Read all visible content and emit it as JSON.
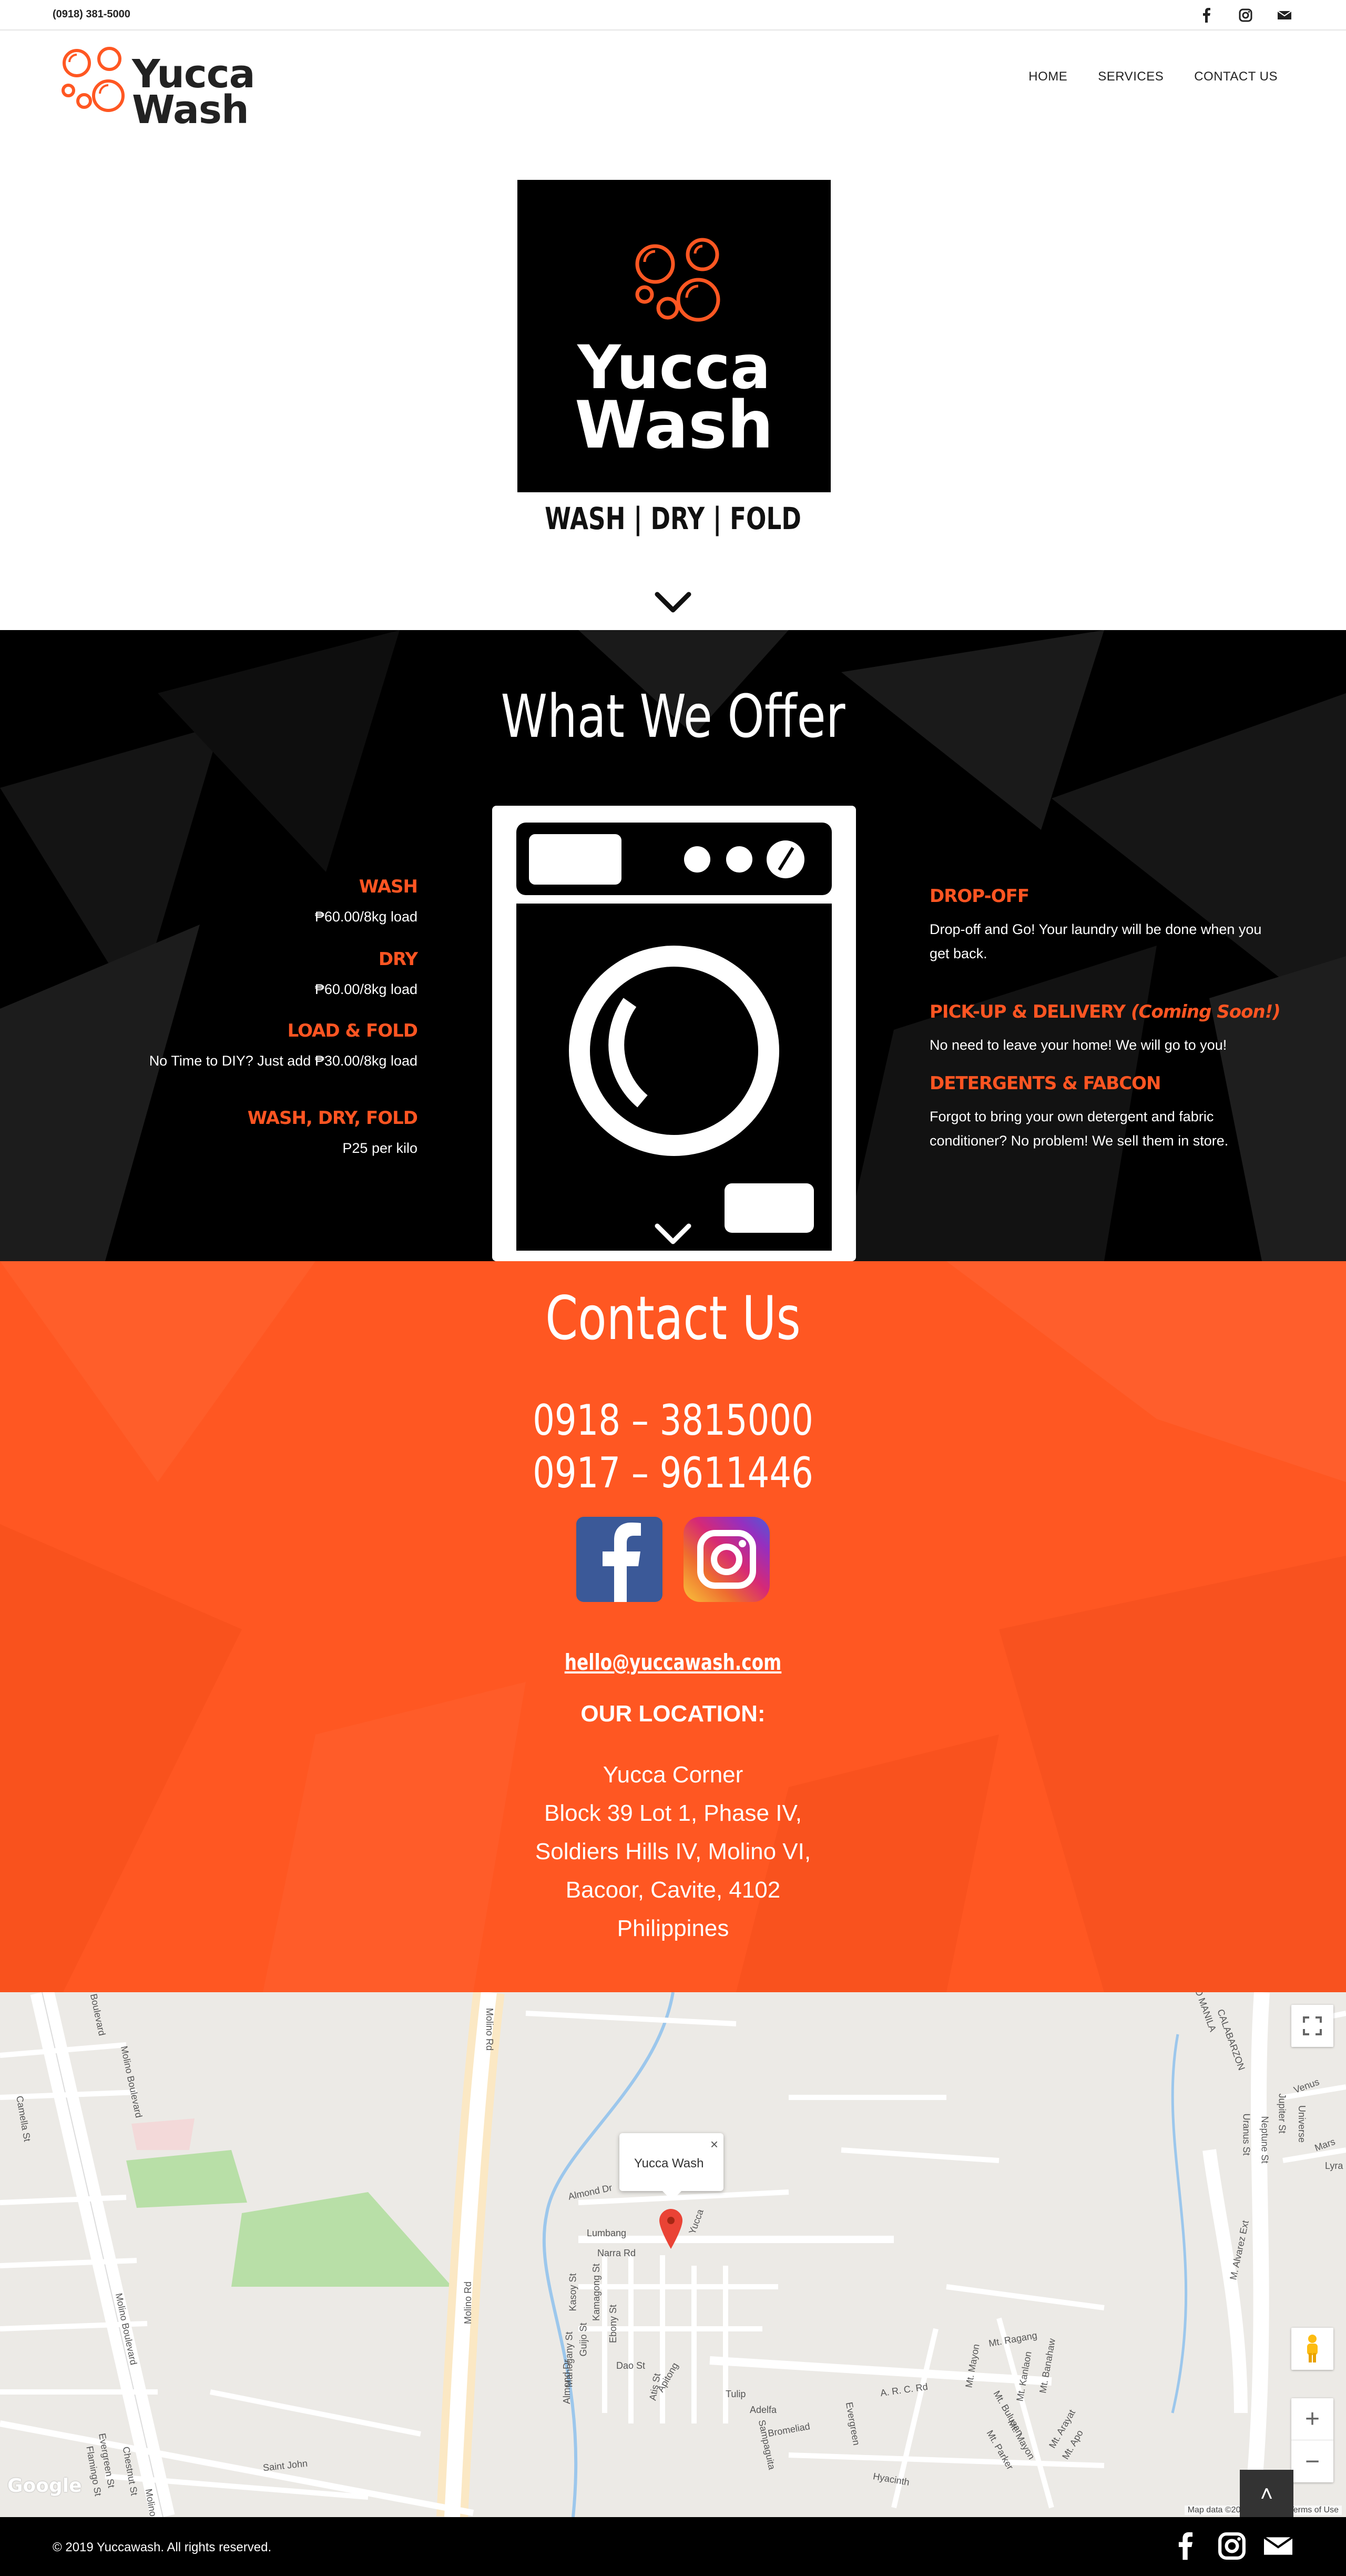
{
  "topbar": {
    "phone": "(0918) 381-5000",
    "social_icons": [
      "facebook-icon",
      "instagram-icon",
      "mail-icon"
    ]
  },
  "brand": {
    "logo_line1": "Yucca",
    "logo_line2": "Wash",
    "accent_color": "#ff5722"
  },
  "nav": {
    "items": [
      "HOME",
      "SERVICES",
      "CONTACT US"
    ]
  },
  "hero": {
    "logo_line1": "Yucca",
    "logo_line2": "Wash",
    "tagline": "WASH | DRY | FOLD",
    "scroll_icon": "chevron-down-icon"
  },
  "offer": {
    "title": "What We Offer",
    "left": [
      {
        "title": "WASH",
        "desc": "₱60.00/8kg load"
      },
      {
        "title": "DRY",
        "desc": "₱60.00/8kg load"
      },
      {
        "title": "LOAD & FOLD",
        "desc": "No Time to DIY? Just add ₱30.00/8kg load"
      },
      {
        "title": "WASH, DRY, FOLD",
        "desc": "P25 per kilo"
      }
    ],
    "right": [
      {
        "title": "DROP-OFF",
        "soon": "",
        "desc1": "Drop-off and Go! Your laundry will be done when you",
        "desc2": "get back."
      },
      {
        "title": "PICK-UP & DELIVERY ",
        "soon": "(Coming Soon!)",
        "desc1": "No need to leave your home! We will go to you!",
        "desc2": ""
      },
      {
        "title": "DETERGENTS & FABCON",
        "soon": "",
        "desc1": "Forgot to bring your own detergent and fabric",
        "desc2": "conditioner? No problem! We sell them in store."
      }
    ]
  },
  "contact": {
    "title": "Contact Us",
    "phones": [
      "0918 – 3815000",
      "0917 – 9611446"
    ],
    "email": "hello@yuccawash.com",
    "location_title": "OUR LOCATION:",
    "address": [
      "Yucca Corner",
      "Block 39 Lot 1, Phase IV,",
      "Soldiers Hills IV, Molino VI,",
      "Bacoor, Cavite, 4102",
      "Philippines"
    ]
  },
  "map": {
    "popup_title": "Yucca Wash",
    "popup_close": "×",
    "streets": [
      "Molino Boulevard",
      "Molino Rd",
      "Almond Dr",
      "Lumbang",
      "Narra Rd",
      "Kasoy St",
      "Kamagong St",
      "Ebony St",
      "Guijo St",
      "Mahogany St",
      "Almond Dr",
      "Dao St",
      "Apitong",
      "Atis St",
      "Tulip",
      "Adelfa",
      "Sampaguita",
      "Bromeliad",
      "Evergreen",
      "Hyacinth",
      "A. R. C. Rd",
      "Mt. Ragang",
      "Mt. Mayon",
      "Mt. Kanlaon",
      "Mt. Banahaw",
      "Mt. Arayat",
      "Mt. Apo",
      "Mt. Parker",
      "Mt. Mayon",
      "Mt. Bulusan",
      "M. Alvarez Ext",
      "CALABARZON",
      "ITRO MANILA",
      "Camella St",
      "Saint John",
      "Evergreen St",
      "Flamingo St",
      "Chestnut St",
      "Venus",
      "Jupiter St",
      "Neptune St",
      "Uranus St",
      "Universe",
      "Mars",
      "Lyra",
      "Molino",
      "Yucca"
    ],
    "google": "Google",
    "attribution": "Map data ©2019 Google",
    "terms": "Terms of Use",
    "zoom_in": "+",
    "zoom_out": "−",
    "back_to_top": "˄"
  },
  "footer": {
    "copyright": "© 2019 Yuccawash. All rights reserved.",
    "social_icons": [
      "facebook-icon",
      "instagram-icon",
      "mail-icon"
    ]
  }
}
